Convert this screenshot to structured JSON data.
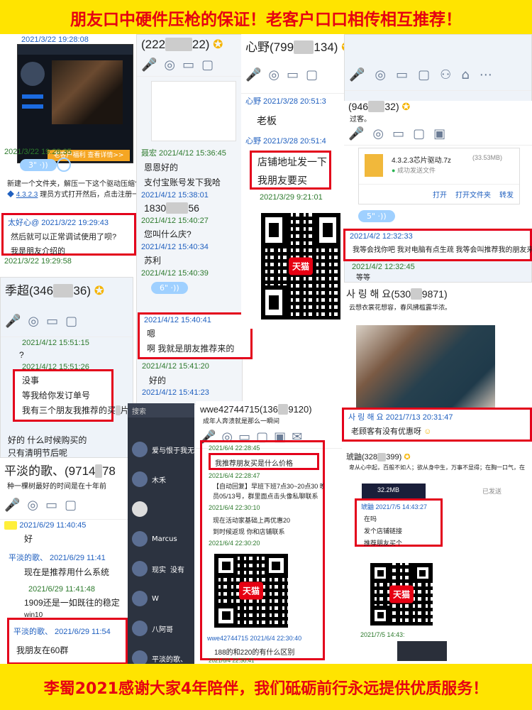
{
  "banner_top": "朋友口中硬件压枪的保证！老客户口口相传相互推荐！",
  "banner_bottom": "李蜀2021感谢大家4年陪伴，我们砥砺前行永远提供优质服务！",
  "p1": {
    "ts1": "2021/3/22 19:28:08",
    "ad_text": "老客户福利 查看详情>>",
    "ts2": "2021/3/22 19:28:35",
    "voice": "3\"",
    "msg1": "新建一个文件夹，解压一下这个驱动压缩包",
    "file": "4.3.2.3",
    "msg2": "理员方式打开然后，点击注册一",
    "sender": "太好心@ 2021/3/22 19:29:43",
    "line1": "然后就可以正常调试使用了呗?",
    "line2": "我是朋友介绍的",
    "ts3": "2021/3/22 19:29:58"
  },
  "p2": {
    "title": "(222",
    "title_end": "22)",
    "s1": "聂宏 2021/4/12 15:36:45",
    "m1": "恩恩好的",
    "m2": "支付宝账号发下我哈",
    "s2": "2021/4/12 15:38:01",
    "m3": "1830",
    "m3_end": "56",
    "s3": "2021/4/12 15:40:27",
    "m4": "您叫什么庆?",
    "s4": "2021/4/12 15:40:34",
    "m5": "苏利",
    "s5": "2021/4/12 15:40:39",
    "voice": "6\"",
    "box_s": "2021/4/12 15:40:41",
    "box_l1": "嗯",
    "box_l2": "啊 我就是朋友推荐来的",
    "s6": "2021/4/12 15:41:20",
    "m6": "好的",
    "s7": "2021/4/12 15:41:23"
  },
  "p3": {
    "title": "心野(799",
    "title_end": "134)",
    "s1": "心野 2021/3/28 20:51:3",
    "m1": "老板",
    "s2": "心野 2021/3/28 20:51:4",
    "box_l1": "店铺地址发一下",
    "box_l2": "我朋友要买",
    "s3": "2021/3/29 9:21:01",
    "tmall": "天猫"
  },
  "p4": {
    "title": "(946",
    "title_end": "32)",
    "sub": "过客。",
    "file_name": "4.3.2.3芯片驱动.7z",
    "file_size": "(33.53MB)",
    "file_status": "成功发送文件",
    "act1": "打开",
    "act2": "打开文件夹",
    "act3": "转发",
    "voice": "5\"",
    "box_s": "2021/4/2 12:32:33",
    "box_m": "我等会找你吧 我对电脑有点生疏 我等会叫推荐我的朋友来",
    "s2": "2021/4/2 12:32:45",
    "m2": "等等"
  },
  "p5": {
    "title": "季超(346",
    "title_end": "36)",
    "s1": "2021/4/12 15:51:15",
    "m1": "?",
    "s2": "2021/4/12 15:51:26",
    "box_l1": "没事",
    "box_l2": "等我给你发订单号",
    "box_l3": "我有三个朋友我推荐的买",
    "box_l3_end": "片",
    "m2": "好的 什么时候购买的",
    "m3": "只有清明节后呢"
  },
  "p6": {
    "title": "平淡的歌、(9714",
    "title_end": "78",
    "sub": "种一棵树最好的时间是在十年前",
    "s1": "2021/6/29 11:40:45",
    "m1": "好",
    "s2": "平淡的歌、 2021/6/29 11:41",
    "m2": "现在是推荐用什么系统",
    "s3": "2021/6/29 11:41:48",
    "m3": "1909还是一如既往的稳定",
    "m4": "win10",
    "box_s": "平淡的歌、 2021/6/29 11:54",
    "box_m": "我朋友在60群"
  },
  "p7": {
    "search": "搜索",
    "c1": "爱与恨于我无",
    "c2": "木禾",
    "c4": "Marcus",
    "c5": "现实",
    "c5_end": "没有",
    "c6": "W",
    "c7": "八阿哥",
    "c8": "平淡的歌、"
  },
  "p8": {
    "title": "wwe42744715(136",
    "title_end": "9120)",
    "sub": "成年人奔溃就是那么一瞬间",
    "s1": "2021/6/4 22:28:45",
    "box_m": "我推荐朋友买是什么价格",
    "s2": "2021/6/4 22:28:47",
    "m1": "【自动回复】早班下班7点30~20点30  晚班",
    "m2": "员05/13号，群里面点击头像私聊联系",
    "s3": "2021/6/4 22:30:10",
    "m3": "现在活动家基础上再优惠20",
    "m4": "到时候返现 你和店铺联系",
    "s4": "2021/6/4 22:30:20",
    "s5": "wwe42744715 2021/6/4 22:30:40",
    "m5": "188的和220的有什么区别",
    "s6": "2021/6/4 22:30:41"
  },
  "p9": {
    "title": "사 링 해 요(530",
    "title_end": "9871)",
    "sub": "云想衣裳花想容，春风拂槛露华浓。",
    "box_s": "사 링 해 요 2021/7/13 20:31:47",
    "box_m": "老顾客有没有优惠呀"
  },
  "p10": {
    "title": "琥鼬(328",
    "title_end": "399)",
    "sub": "卑从心中起，百般不如人；欲从身中生，万事不显得；在胸一口气，在",
    "size": "32.2MB",
    "sent": "已发送",
    "box_s": "琥鼬 2021/7/5 14:43:27",
    "box_l1": "在吗",
    "box_l2": "发个店铺链接",
    "box_l3": "推荐朋友买个",
    "s1": "2021/7/5 14:43:"
  }
}
